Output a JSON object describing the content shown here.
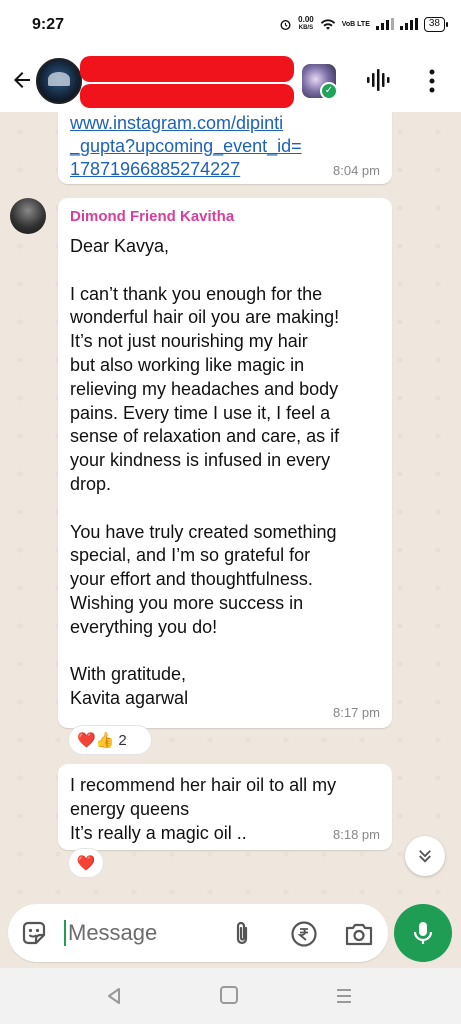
{
  "status": {
    "time": "9:27",
    "net_speed_value": "0.00",
    "net_speed_unit": "KB/S",
    "volte": "VoB LTE",
    "battery": "38"
  },
  "chat": {
    "message1": {
      "link_lines": [
        "www.instagram.com/dipinti",
        "_gupta?upcoming_event_id=",
        "17871966885274227"
      ],
      "time": "8:04 pm"
    },
    "message2": {
      "sender": "Dimond Friend Kavitha",
      "lines": [
        "Dear Kavya,",
        "",
        "I can’t thank you enough for the",
        "wonderful hair oil you are making!",
        "It’s not just nourishing my hair",
        "but also working like magic in",
        "relieving my headaches and body",
        "pains. Every time I use it, I feel a",
        "sense of relaxation and care, as if",
        "your kindness is infused in every",
        "drop.",
        "",
        "You have truly created something",
        "special, and I’m so grateful for",
        "your effort and thoughtfulness.",
        "Wishing you more success in",
        "everything you do!",
        "",
        "With gratitude,",
        "Kavita agarwal"
      ],
      "time": "8:17 pm",
      "reactions": {
        "emojis": "❤️👍",
        "count": "2"
      }
    },
    "message3": {
      "lines": [
        "I recommend her hair oil to all my",
        "energy queens",
        "It’s really a magic oil .."
      ],
      "time": "8:18 pm",
      "reactions": {
        "emojis": "❤️"
      }
    }
  },
  "composer": {
    "placeholder": "Message"
  },
  "colors": {
    "accent": "#1f9d55",
    "sender_name": "#d63f9b",
    "link": "#1d62b8",
    "redaction": "#f0131b"
  }
}
